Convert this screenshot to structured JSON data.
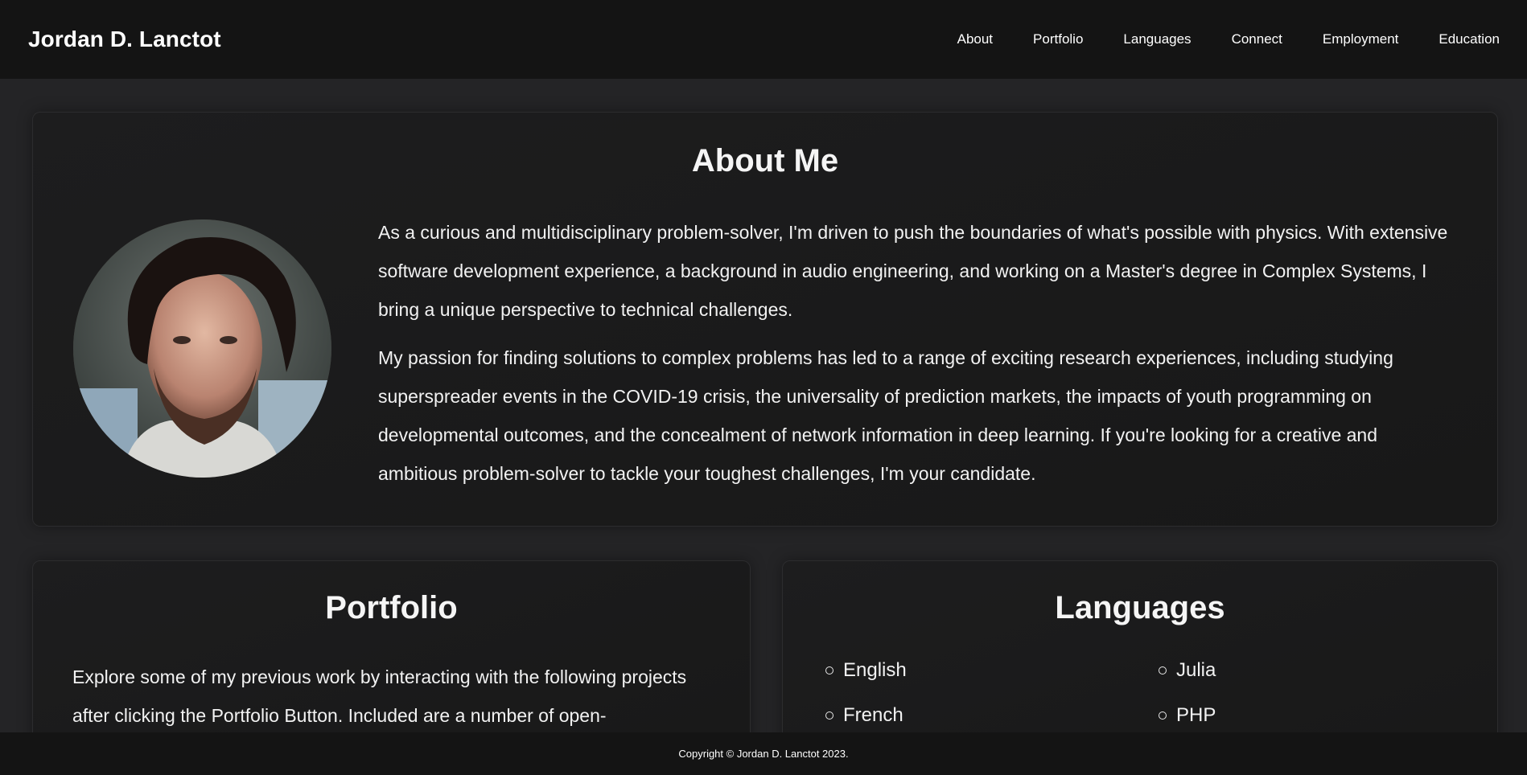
{
  "header": {
    "brand": "Jordan D. Lanctot",
    "nav": [
      "About",
      "Portfolio",
      "Languages",
      "Connect",
      "Employment",
      "Education"
    ]
  },
  "about": {
    "title": "About Me",
    "paragraphs": [
      "As a curious and multidisciplinary problem-solver, I'm driven to push the boundaries of what's possible with physics. With extensive software development experience, a background in audio engineering, and working on a Master's degree in Complex Systems, I bring a unique perspective to technical challenges.",
      "My passion for finding solutions to complex problems has led to a range of exciting research experiences, including studying superspreader events in the COVID-19 crisis, the universality of prediction markets, the impacts of youth programming on developmental outcomes, and the concealment of network information in deep learning. If you're looking for a creative and ambitious problem-solver to tackle your toughest challenges, I'm your candidate."
    ]
  },
  "portfolio": {
    "title": "Portfolio",
    "text": "Explore some of my previous work by interacting with the following projects after clicking the Portfolio Button. Included are a number of open-"
  },
  "languages": {
    "title": "Languages",
    "left": [
      "English",
      "French"
    ],
    "right": [
      "Julia",
      "PHP"
    ]
  },
  "footer": {
    "text": "Copyright © Jordan D. Lanctot 2023."
  }
}
